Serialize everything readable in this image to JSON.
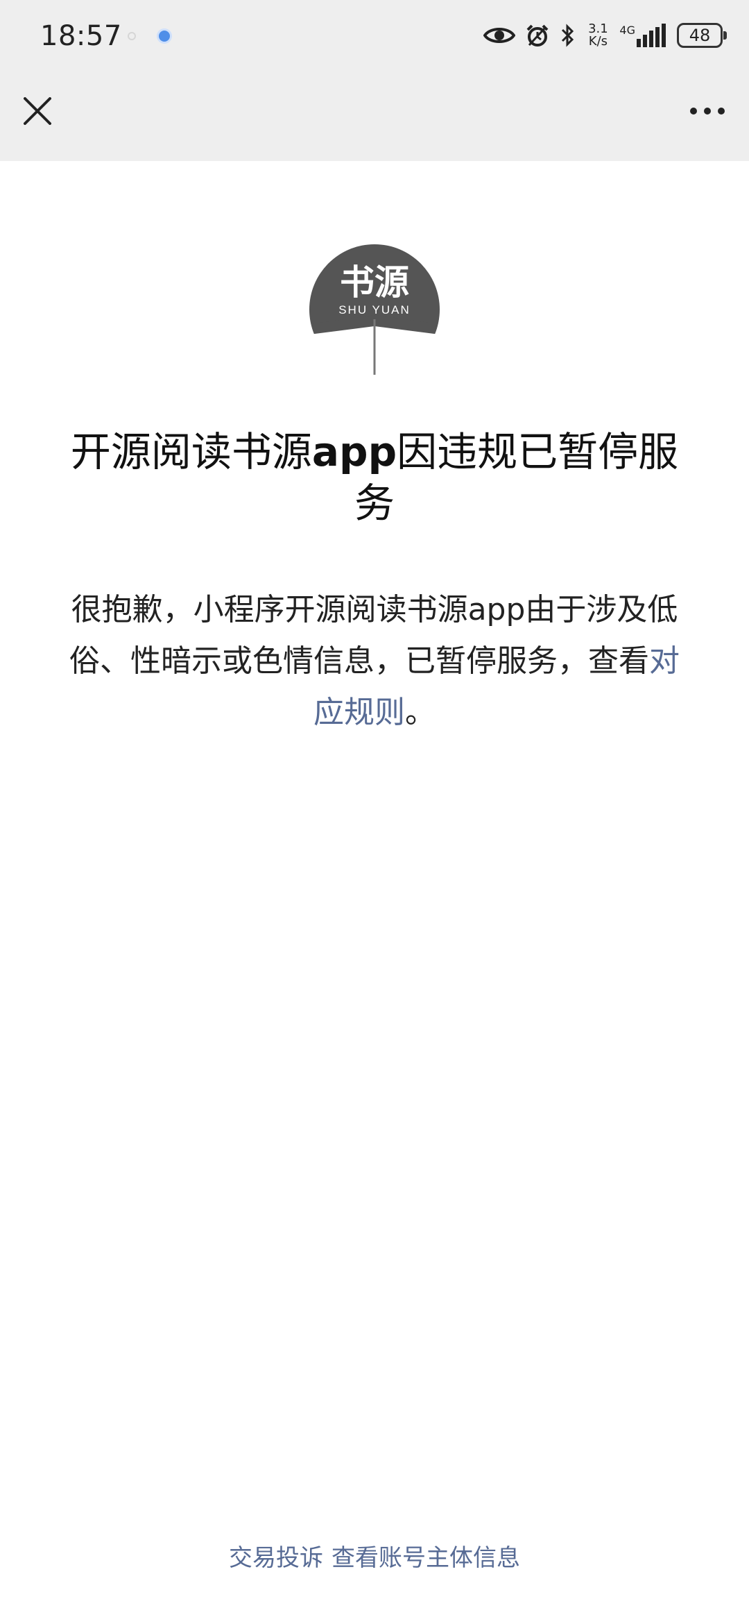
{
  "status_bar": {
    "time": "18:57",
    "net_speed_value": "3.1",
    "net_speed_unit": "K/s",
    "network_type": "4G",
    "battery": "48",
    "icons": [
      "eye-icon",
      "alarm-icon",
      "bluetooth-icon",
      "signal-icon",
      "battery-icon"
    ]
  },
  "nav": {
    "close_icon": "close-icon",
    "more_icon": "more-icon"
  },
  "logo": {
    "text_cn": "书源",
    "text_en": "SHU YUAN"
  },
  "notice": {
    "title_part1": "开源阅读书源",
    "title_part2": "app",
    "title_part3": "因违规已暂停服务",
    "desc_before_link": "很抱歉，小程序开源阅读书源app由于涉及低俗、性暗示或色情信息，已暂停服务，查看",
    "link_text": "对应规则",
    "desc_after_link": "。"
  },
  "footer": {
    "complaint_link": "交易投诉",
    "account_link": "查看账号主体信息"
  },
  "colors": {
    "link": "#576b95",
    "chrome_bg": "#eeeeee",
    "logo_dark": "#555555"
  }
}
